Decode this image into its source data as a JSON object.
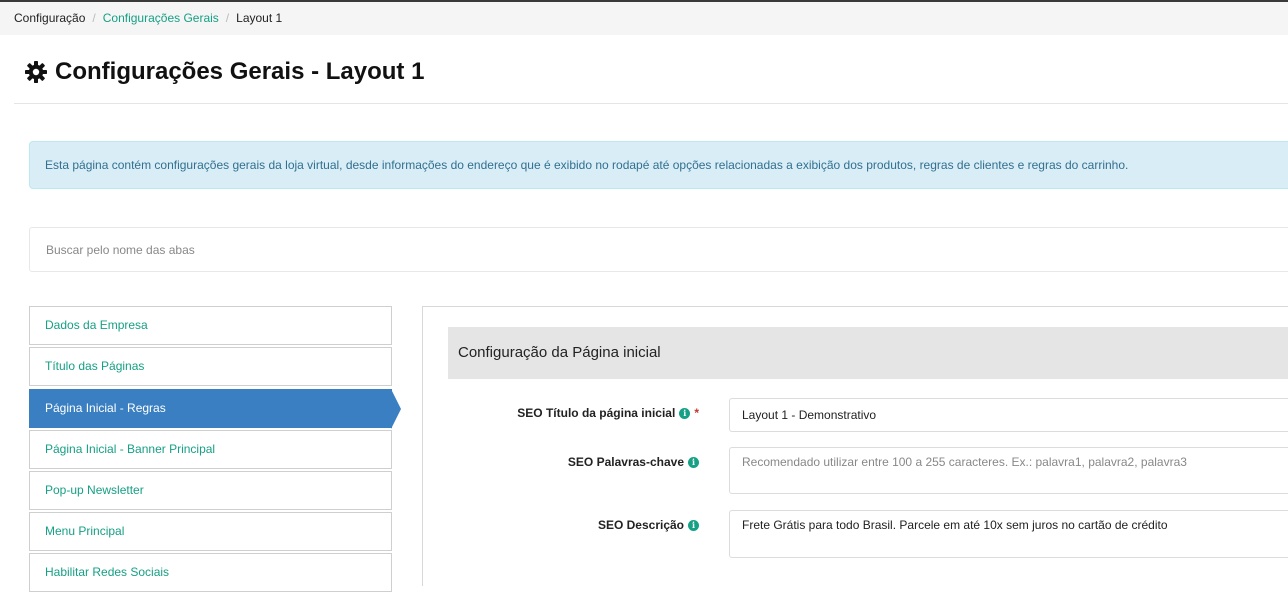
{
  "breadcrumb": {
    "items": [
      "Configuração",
      "Configurações Gerais",
      "Layout 1"
    ],
    "separator": "/"
  },
  "header": {
    "title": "Configurações Gerais - Layout 1",
    "icon": "gear-icon"
  },
  "alert": {
    "text": "Esta página contém configurações gerais da loja virtual, desde informações do endereço que é exibido no rodapé até opções relacionadas a exibição dos produtos, regras de clientes e regras do carrinho."
  },
  "search": {
    "placeholder": "Buscar pelo nome das abas",
    "value": ""
  },
  "sidebar": {
    "items": [
      {
        "label": "Dados da Empresa"
      },
      {
        "label": "Título das Páginas"
      },
      {
        "label": "Página Inicial - Regras",
        "active": true
      },
      {
        "label": "Página Inicial - Banner Principal"
      },
      {
        "label": "Pop-up Newsletter"
      },
      {
        "label": "Menu Principal"
      },
      {
        "label": "Habilitar Redes Sociais"
      }
    ]
  },
  "section": {
    "title": "Configuração da Página inicial"
  },
  "form": {
    "seo_title": {
      "label": "SEO Título da página inicial",
      "required": "*",
      "value": "Layout 1 - Demonstrativo"
    },
    "seo_keywords": {
      "label": "SEO Palavras-chave",
      "placeholder": "Recomendado utilizar entre 100 a 255 caracteres. Ex.: palavra1, palavra2, palavra3",
      "value": ""
    },
    "seo_description": {
      "label": "SEO Descrição",
      "value": "Frete Grátis para todo Brasil. Parcele em até 10x sem juros no cartão de crédito"
    },
    "info_icon_glyph": "i"
  },
  "colors": {
    "accent": "#16a085",
    "active_tab": "#3a7fc1",
    "alert_bg": "#d9edf7",
    "alert_text": "#31708f",
    "required": "#c0392b"
  }
}
